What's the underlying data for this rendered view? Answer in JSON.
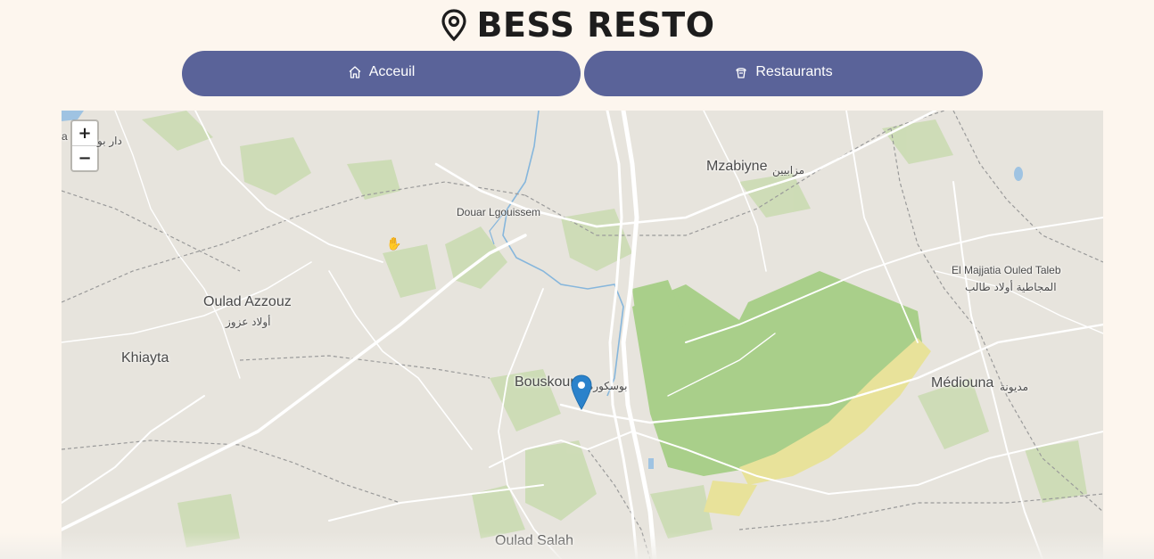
{
  "app": {
    "title": "BESS RESTO",
    "icon": "map-pin-icon"
  },
  "nav": {
    "home": {
      "label": "Acceuil",
      "icon": "home-icon"
    },
    "restaurants": {
      "label": "Restaurants",
      "icon": "restaurant-icon"
    }
  },
  "map": {
    "zoom_in": "+",
    "zoom_out": "−",
    "places": {
      "dar_bou": "دار بو",
      "a": "a",
      "mzabiyne": "Mzabiyne",
      "mzabiyne_ar": "مزابيين",
      "douar": "Douar Lgouissem",
      "oulad_azzouz": "Oulad Azzouz",
      "oulad_azzouz_ar": "أولاد عزوز",
      "khiayta": "Khiayta",
      "bouskoura": "Bouskoura",
      "bouskoura_ar": "بوسكورة",
      "majjatia": "El Majjatia Ouled Taleb",
      "majjatia_ar": "المجاطية أولاد طالب",
      "mediouna": "Médiouna",
      "mediouna_ar": "مديونة",
      "oulad_salah": "Oulad Salah"
    },
    "marker_color": "#2b82cb"
  },
  "colors": {
    "background": "#fdf6ee",
    "nav_button": "#5a6399",
    "forest": "#a9cf8a",
    "sand": "#e8e29a"
  }
}
